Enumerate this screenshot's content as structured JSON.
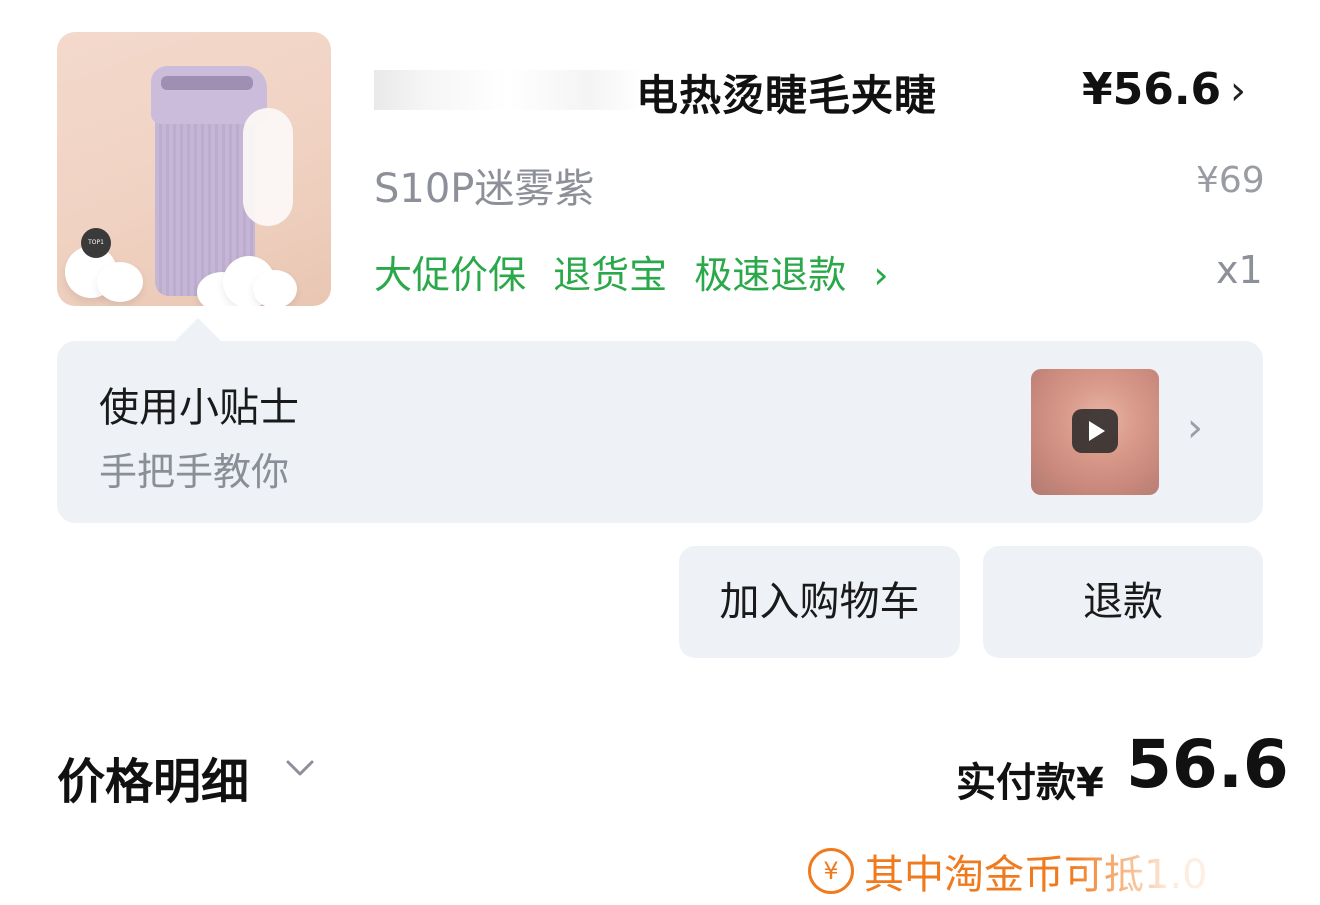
{
  "product": {
    "title": "电热烫睫毛夹睫",
    "price": "¥56.6",
    "sku": "S10P迷雾紫",
    "original_price": "¥69",
    "quantity": "x1",
    "image_badge": "TOP1",
    "services": [
      "大促价保",
      "退货宝",
      "极速退款"
    ],
    "service_chevron": "›"
  },
  "tips": {
    "title": "使用小贴士",
    "subtitle": "手把手教你"
  },
  "actions": {
    "add_to_cart": "加入购物车",
    "refund": "退款"
  },
  "price_detail": {
    "label": "价格明细",
    "paid_label": "实付款¥",
    "paid_amount": "56.6",
    "coin_note": "其中淘金币可抵1.0"
  },
  "icons": {
    "product_chevron": "chevron-right-icon",
    "tips_chevron": "chevron-right-icon",
    "play": "play-icon",
    "detail_toggle": "chevron-down-icon",
    "coin": "yuan-coin-icon"
  },
  "colors": {
    "service_green": "#2aa84a",
    "coin_orange": "#f07a1e",
    "card_bg": "#eef2f7",
    "muted_text": "#8d9098"
  }
}
